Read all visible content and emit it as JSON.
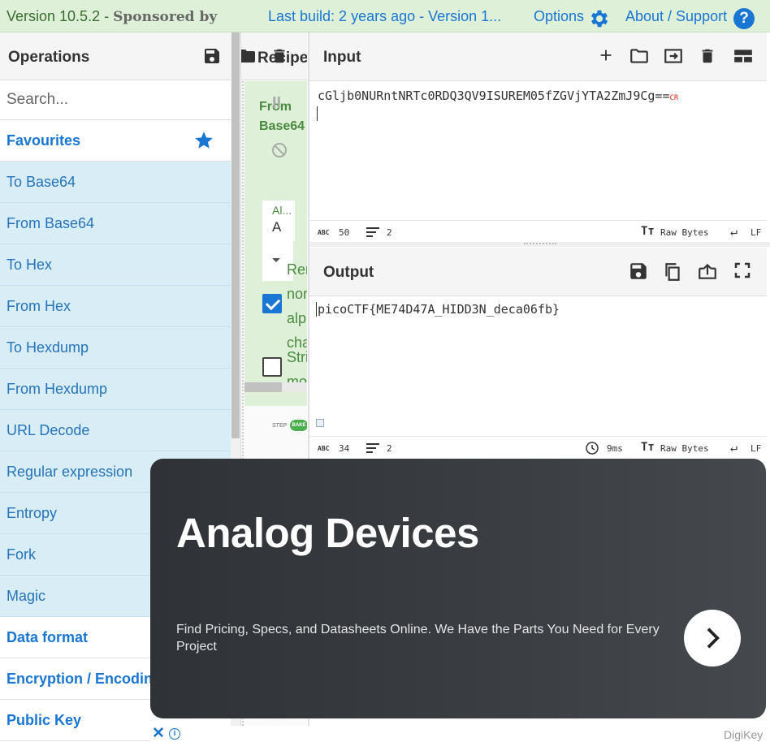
{
  "banner": {
    "version": "Version 10.5.2 - ",
    "sponsored": "Sponsored by",
    "last_build": "Last build: 2 years ago - Version 1...",
    "options": "Options",
    "about": "About / Support",
    "help_glyph": "?"
  },
  "operations": {
    "title": "Operations",
    "search_placeholder": "Search...",
    "favourites_label": "Favourites",
    "favourites": [
      "To Base64",
      "From Base64",
      "To Hex",
      "From Hex",
      "To Hexdump",
      "From Hexdump",
      "URL Decode",
      "Regular expression",
      "Entropy",
      "Fork",
      "Magic"
    ],
    "categories": [
      "Data format",
      "Encryption / Encoding",
      "Public Key"
    ]
  },
  "recipe": {
    "title": "Recipe",
    "operation": {
      "name": "From Base64",
      "pause_glyph": "II",
      "alphabet_label": "Al...",
      "alphabet_value": "A",
      "remove_nonalpha_label": "Remove non-alphabet chars",
      "remove_nonalpha_checked": true,
      "strict_mode_label": "Strict mode",
      "strict_mode_checked": false
    },
    "mini_step": "STEP",
    "mini_bake": "BAKE"
  },
  "input": {
    "title": "Input",
    "text": "cGljb0NURntNRTc0RDQ3QV9ISUREM05fZGVjYTA2ZmJ9Cg==",
    "line_ending_marker": "CR",
    "status": {
      "length": "50",
      "lines": "2",
      "encoding": "Raw Bytes",
      "eol": "LF"
    }
  },
  "output": {
    "title": "Output",
    "text": "picoCTF{ME74D47A_HIDD3N_deca06fb}",
    "status": {
      "length": "34",
      "lines": "2",
      "time": "9ms",
      "encoding": "Raw Bytes",
      "eol": "LF"
    }
  },
  "ad": {
    "headline": "Analog Devices",
    "body": "Find Pricing, Specs, and Datasheets Online. We Have the Parts You Need for Every Project",
    "close_glyph": "✕",
    "info_glyph": "i",
    "brand": "DigiKey"
  },
  "icons": {
    "save": "save-icon",
    "folder": "folder-icon",
    "delete": "trash-icon",
    "add": "plus-icon",
    "open_folder": "folder-icon",
    "load": "import-icon",
    "layout": "layout-icon",
    "copy": "copy-icon",
    "replace_input": "upload-icon",
    "maximise": "maximise-icon",
    "options": "gear-icon",
    "favourite": "star-icon"
  },
  "colors": {
    "accent": "#1976d2",
    "favourites_bg": "#d9edf7",
    "banner_bg": "#dff0d8",
    "ad_bg": "#2f3237"
  }
}
